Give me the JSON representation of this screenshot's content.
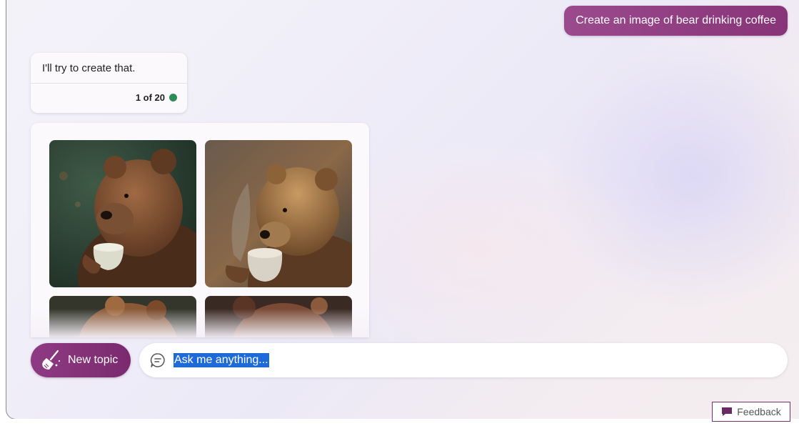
{
  "conversation": {
    "user_message": "Create an image of bear drinking coffee",
    "bot_message": {
      "text": "I'll try to create that.",
      "counter": "1 of 20",
      "status_color": "#2e8b57"
    },
    "image_results": [
      {
        "icon": "bear-drinking-coffee-image"
      },
      {
        "icon": "bear-drinking-coffee-image"
      },
      {
        "icon": "bear-drinking-coffee-image"
      },
      {
        "icon": "bear-drinking-coffee-image"
      }
    ]
  },
  "composer": {
    "new_topic_label": "New topic",
    "new_topic_icon": "broom-icon",
    "input_placeholder": "Ask me anything...",
    "input_icon": "chat-bubble-icon"
  },
  "footer": {
    "feedback_label": "Feedback",
    "feedback_icon": "message-icon"
  },
  "colors": {
    "accent": "#8e3b83",
    "selection": "#1e6ad8"
  }
}
